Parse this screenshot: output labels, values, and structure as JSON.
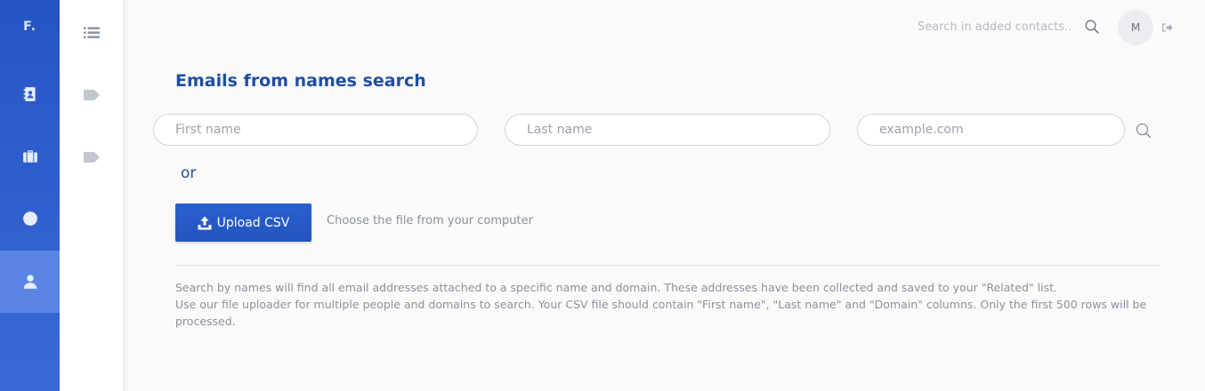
{
  "rail": {
    "logo": "F.",
    "items": [
      {
        "icon": "contacts-book-icon"
      },
      {
        "icon": "briefcase-icon"
      },
      {
        "icon": "globe-icon"
      },
      {
        "icon": "user-icon",
        "active": true
      }
    ]
  },
  "secondary_nav": {
    "items": [
      {
        "icon": "list-icon"
      },
      {
        "icon": "tag-icon"
      },
      {
        "icon": "tag-icon"
      }
    ]
  },
  "header": {
    "search_placeholder": "Search in added contacts..",
    "avatar_initial": "M"
  },
  "main": {
    "title": "Emails from names search",
    "first_name_placeholder": "First name",
    "last_name_placeholder": "Last name",
    "domain_placeholder": "example.com",
    "or_label": "or",
    "upload_label": "Upload CSV",
    "choose_hint": "Choose the file from your computer",
    "help_line1": "Search by names will find all email addresses attached to a specific name and domain. These addresses have been collected and saved to your \"Related\" list.",
    "help_line2": "Use our file uploader for multiple people and domains to search. Your CSV file should contain \"First name\", \"Last name\" and \"Domain\" columns. Only the first 500 rows will be processed."
  },
  "colors": {
    "rail": "#2455c3",
    "rail_active": "#5b85e2",
    "accent": "#1f4ea3",
    "button": "#2355bd"
  }
}
